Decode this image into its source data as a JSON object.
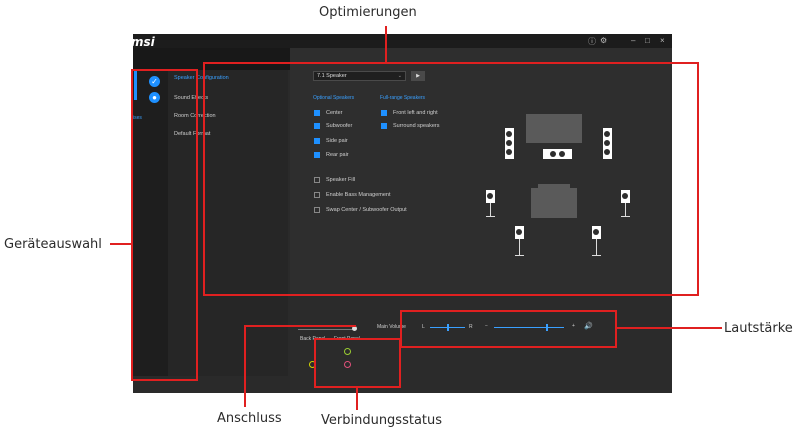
{
  "callouts": {
    "top": "Optimierungen",
    "left": "Geräteauswahl",
    "right": "Lautstärke",
    "bottom_left": "Anschluss",
    "bottom_right": "Verbindungsstatus"
  },
  "app": {
    "logo": "msi",
    "titlebar_icons": [
      "info-icon",
      "settings-icon",
      "minimize-icon",
      "maximize-icon",
      "close-icon"
    ],
    "device_tab_label": "ises",
    "nav": {
      "items": [
        {
          "label": "Speaker Configuration",
          "active": true
        },
        {
          "label": "Sound Effects",
          "active": false
        },
        {
          "label": "Room Correction",
          "active": false
        },
        {
          "label": "Default Format",
          "active": false
        }
      ]
    },
    "config": {
      "dropdown_value": "7.1 Speaker",
      "optional_speakers_heading": "Optional Speakers",
      "full_range_heading": "Full-range Speakers",
      "optional": [
        {
          "label": "Center",
          "checked": true
        },
        {
          "label": "Subwoofer",
          "checked": true
        },
        {
          "label": "Side pair",
          "checked": true
        },
        {
          "label": "Rear pair",
          "checked": true
        }
      ],
      "full_range": [
        {
          "label": "Front left and right",
          "checked": true
        },
        {
          "label": "Surround speakers",
          "checked": true
        }
      ],
      "options": [
        {
          "label": "Speaker Fill",
          "checked": false
        },
        {
          "label": "Enable Bass Management",
          "checked": false
        },
        {
          "label": "Swap Center / Subwoofer Output",
          "checked": false
        }
      ]
    },
    "volume": {
      "label": "Main Volume",
      "left": "L",
      "right": "R",
      "minus": "−",
      "plus": "+",
      "balance_position": 0.5,
      "level": 0.75
    },
    "connectors": {
      "back_panel": "Back Panel",
      "front_panel": "Front Panel",
      "front_jack_colors": [
        "#9acd32",
        "#e0507a"
      ],
      "back_jack_color": "#d4d400"
    }
  }
}
